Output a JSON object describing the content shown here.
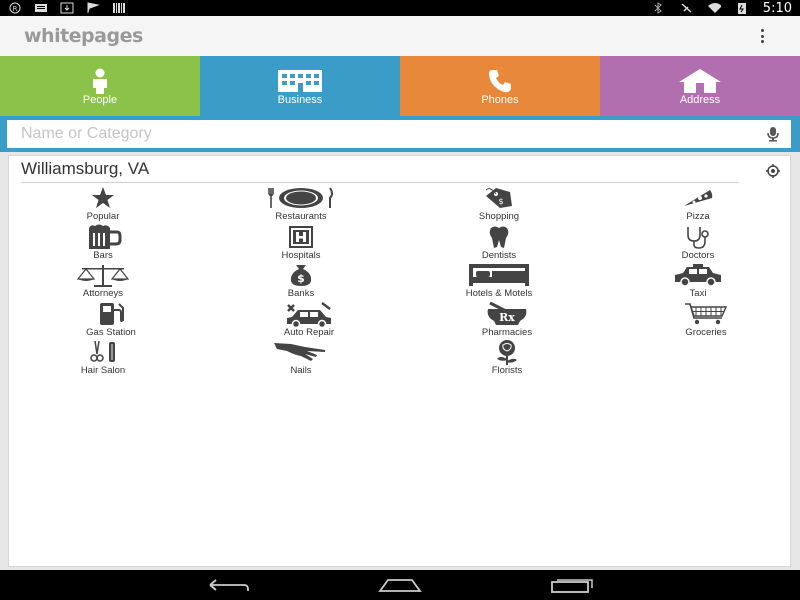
{
  "status_bar": {
    "time": "5:10",
    "left_icons": [
      "registered-icon",
      "message-icon",
      "download-icon",
      "flag-icon",
      "barcode-icon"
    ],
    "right_icons": [
      "bluetooth-icon",
      "mute-icon",
      "wifi-icon",
      "battery-icon"
    ]
  },
  "app": {
    "logo_text": "whitepages"
  },
  "tabs": [
    {
      "label": "People",
      "color": "#8bc34a",
      "icon": "person-icon"
    },
    {
      "label": "Business",
      "color": "#3a9dc7",
      "icon": "building-icon"
    },
    {
      "label": "Phones",
      "color": "#e8883a",
      "icon": "phone-icon"
    },
    {
      "label": "Address",
      "color": "#b26fb0",
      "icon": "house-icon"
    }
  ],
  "search": {
    "placeholder": "Name or Category",
    "value": ""
  },
  "location": "Williamsburg, VA",
  "categories": [
    {
      "label": "Popular",
      "icon": "star-icon"
    },
    {
      "label": "Restaurants",
      "icon": "plate-icon"
    },
    {
      "label": "Shopping",
      "icon": "shopping-tag-icon"
    },
    {
      "label": "Pizza",
      "icon": "pizza-icon"
    },
    {
      "label": "Bars",
      "icon": "beer-mug-icon"
    },
    {
      "label": "Hospitals",
      "icon": "hospital-icon"
    },
    {
      "label": "Dentists",
      "icon": "tooth-icon"
    },
    {
      "label": "Doctors",
      "icon": "stethoscope-icon"
    },
    {
      "label": "Attorneys",
      "icon": "scales-icon"
    },
    {
      "label": "Banks",
      "icon": "money-bag-icon"
    },
    {
      "label": "Hotels & Motels",
      "icon": "bed-icon"
    },
    {
      "label": "Taxi",
      "icon": "taxi-icon"
    },
    {
      "label": "Gas Station",
      "icon": "gas-pump-icon"
    },
    {
      "label": "Auto Repair",
      "icon": "car-repair-icon"
    },
    {
      "label": "Pharmacies",
      "icon": "pharmacy-icon"
    },
    {
      "label": "Groceries",
      "icon": "cart-icon"
    },
    {
      "label": "Hair Salon",
      "icon": "scissors-icon"
    },
    {
      "label": "Nails",
      "icon": "hand-icon"
    },
    {
      "label": "Florists",
      "icon": "rose-icon"
    }
  ],
  "nav": [
    "back-icon",
    "home-icon",
    "recents-icon"
  ]
}
